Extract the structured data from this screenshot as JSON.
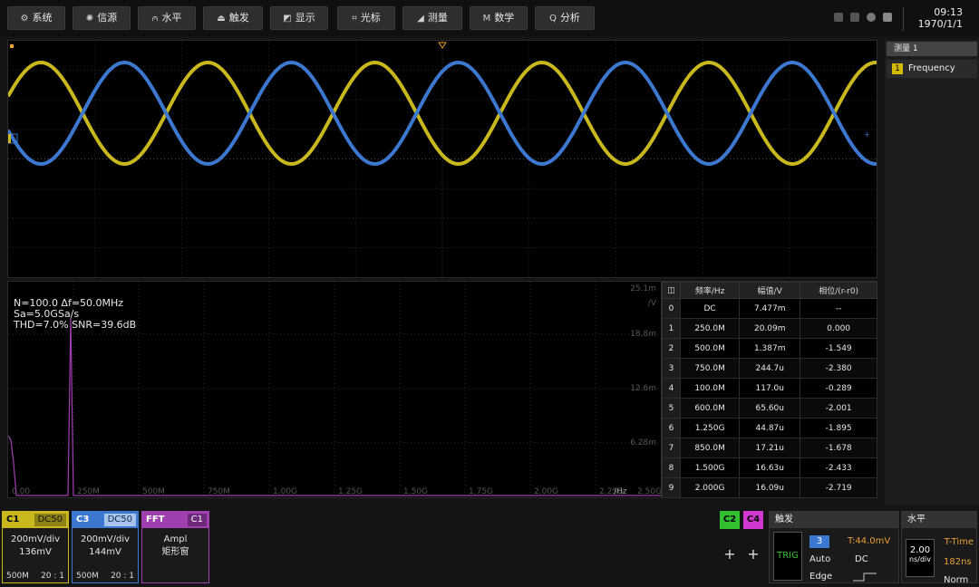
{
  "toolbar": {
    "buttons": [
      {
        "label": "系统",
        "icon": "gear-icon",
        "glyph": "⚙"
      },
      {
        "label": "信源",
        "icon": "source-icon",
        "glyph": "✺"
      },
      {
        "label": "水平",
        "icon": "horizontal-icon",
        "glyph": "⩀"
      },
      {
        "label": "触发",
        "icon": "trigger-icon",
        "glyph": "⏏"
      },
      {
        "label": "显示",
        "icon": "display-icon",
        "glyph": "◩"
      },
      {
        "label": "光标",
        "icon": "cursor-icon",
        "glyph": "⌗"
      },
      {
        "label": "测量",
        "icon": "measure-icon",
        "glyph": "◢"
      },
      {
        "label": "数学",
        "icon": "math-icon",
        "glyph": "M"
      },
      {
        "label": "分析",
        "icon": "search-icon",
        "glyph": "Q"
      }
    ],
    "time": "09:13",
    "date": "1970/1/1"
  },
  "colors": {
    "ch1": "#c8b81e",
    "ch2": "#30c030",
    "ch3": "#3c78d0",
    "ch4": "#d038d0",
    "fft": "#a040b0",
    "grid": "#3a3a3a"
  },
  "waveform": {
    "period_ratio": 5.2,
    "phase_offset_deg": 180
  },
  "fft": {
    "info": [
      "N=100.0 Δf=50.0MHz",
      " Sa=5.0GSa/s",
      "THD=7.0% SNR=39.6dB"
    ],
    "y_ticks": [
      "25.1m",
      "/V",
      "18.8m",
      "12.6m",
      "6.28m"
    ],
    "x_ticks": [
      "0.00",
      "250M",
      "500M",
      "750M",
      "1.00G",
      "1.25G",
      "1.50G",
      "1.75G",
      "2.00G",
      "2.25G"
    ],
    "x_unit": "/Hz",
    "x_end": "2.50G",
    "table": {
      "headers": [
        "频率/Hz",
        "幅值/V",
        "相位/(r-r0)"
      ],
      "rows": [
        {
          "idx": "0",
          "freq": "DC",
          "amp": "7.477m",
          "phase": "--"
        },
        {
          "idx": "1",
          "freq": "250.0M",
          "amp": "20.09m",
          "phase": "0.000"
        },
        {
          "idx": "2",
          "freq": "500.0M",
          "amp": "1.387m",
          "phase": "-1.549"
        },
        {
          "idx": "3",
          "freq": "750.0M",
          "amp": "244.7u",
          "phase": "-2.380"
        },
        {
          "idx": "4",
          "freq": "100.0M",
          "amp": "117.0u",
          "phase": "-0.289"
        },
        {
          "idx": "5",
          "freq": "600.0M",
          "amp": "65.60u",
          "phase": "-2.001"
        },
        {
          "idx": "6",
          "freq": "1.250G",
          "amp": "44.87u",
          "phase": "-1.895"
        },
        {
          "idx": "7",
          "freq": "850.0M",
          "amp": "17.21u",
          "phase": "-1.678"
        },
        {
          "idx": "8",
          "freq": "1.500G",
          "amp": "16.63u",
          "phase": "-2.433"
        },
        {
          "idx": "9",
          "freq": "2.000G",
          "amp": "16.09u",
          "phase": "-2.719"
        }
      ]
    }
  },
  "sidebar": {
    "title": "测量 1",
    "item_num": "1",
    "item_label": "Frequency"
  },
  "channels": {
    "c1": {
      "name": "C1",
      "coupling": "DC50",
      "scale": "200mV/div",
      "offset": "136mV",
      "bw": "500M",
      "probe": "20 : 1"
    },
    "c3": {
      "name": "C3",
      "coupling": "DC50",
      "scale": "200mV/div",
      "offset": "144mV",
      "bw": "500M",
      "probe": "20 : 1"
    },
    "fft": {
      "name": "FFT",
      "src": "C1",
      "mode": "Ampl",
      "window": "矩形窗"
    },
    "c2": {
      "name": "C2",
      "plus": "+"
    },
    "c4": {
      "name": "C4",
      "plus": "+"
    }
  },
  "trigger": {
    "title": "触发",
    "trig": "TRIG",
    "source": "3",
    "level": "T:44.0mV",
    "mode": "Auto",
    "coupling": "DC",
    "type": "Edge"
  },
  "horizontal": {
    "title": "水平",
    "timebase": "2.00",
    "unit": "ns/div",
    "mode": "T-Time",
    "delay": "182ns",
    "acq": "Norm"
  }
}
